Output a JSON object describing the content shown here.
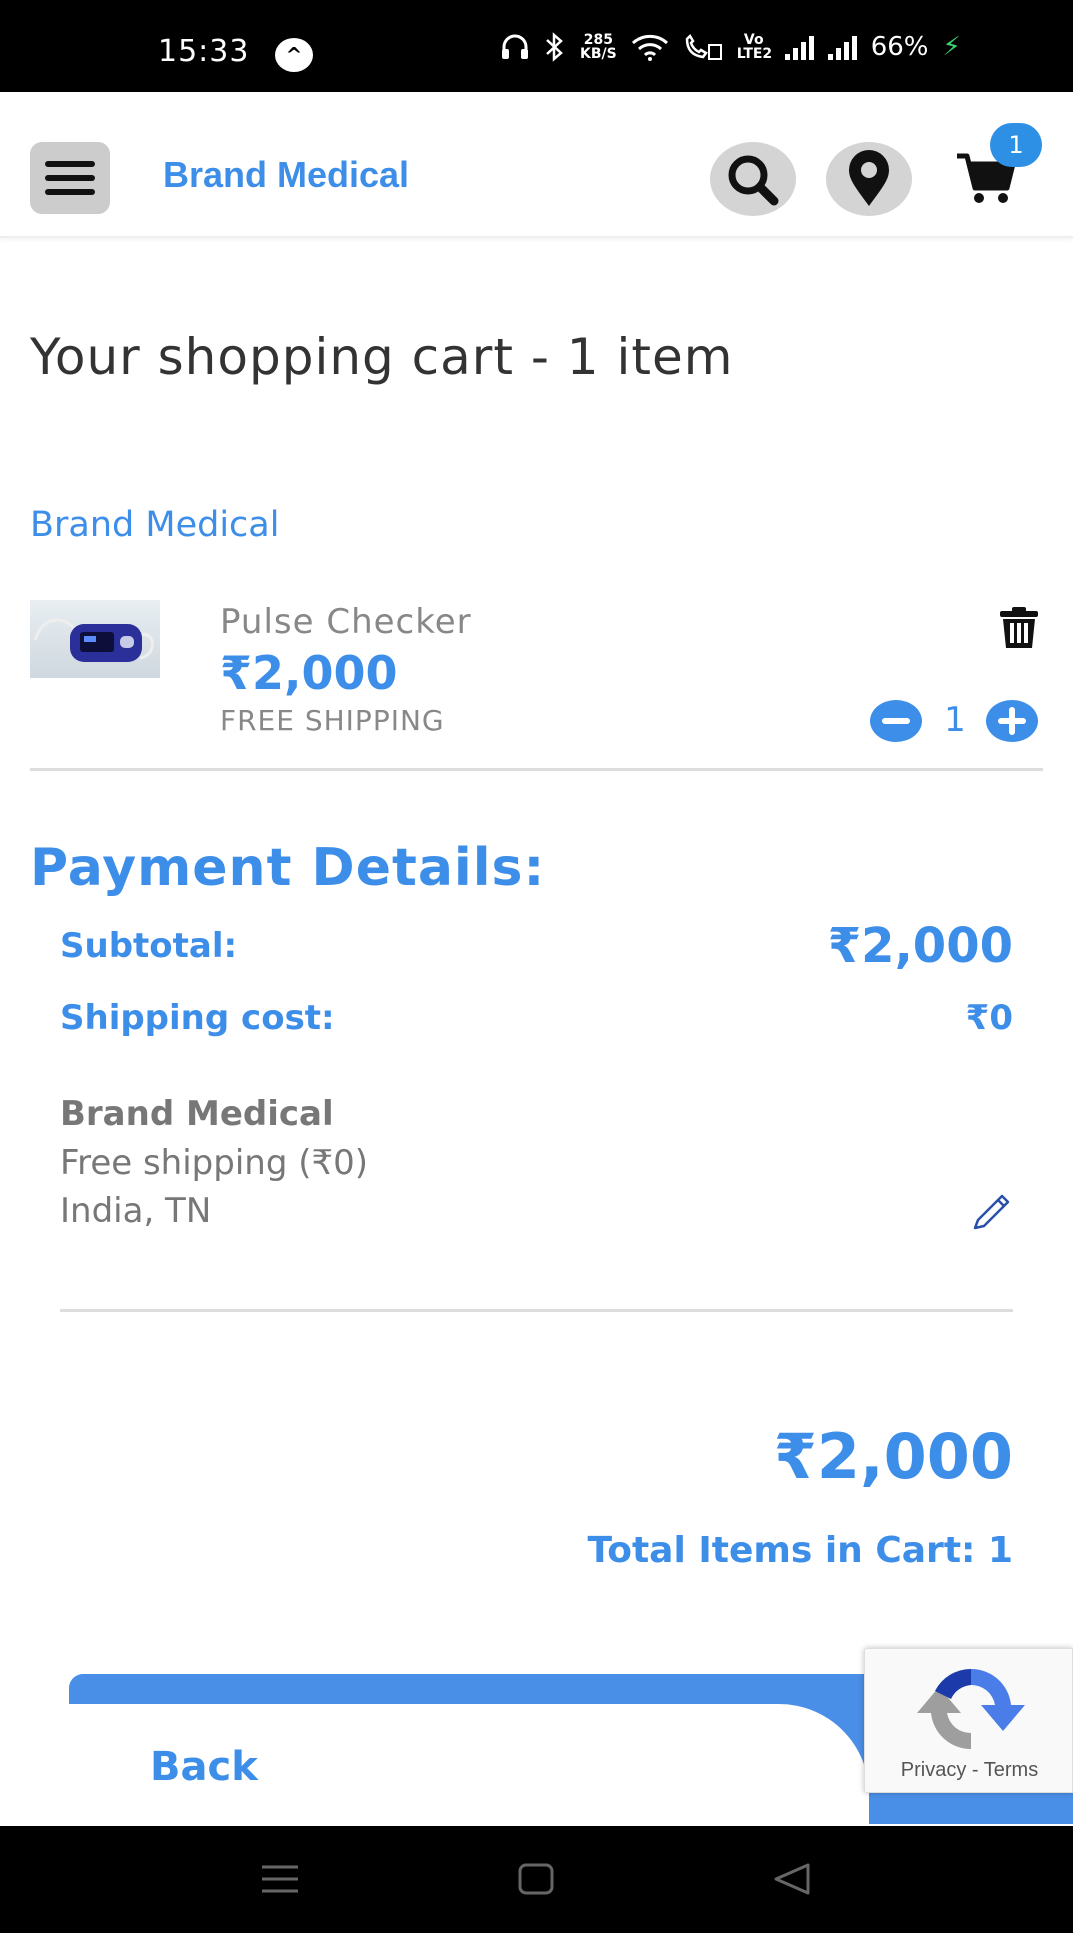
{
  "status_bar": {
    "time": "15:33",
    "net_speed_value": "285",
    "net_speed_unit": "KB/S",
    "volte": "Vo LTE2",
    "battery": "66%"
  },
  "header": {
    "brand": "Brand Medical",
    "cart_count": "1"
  },
  "cart": {
    "title": "Your shopping cart - 1 item",
    "seller": "Brand Medical",
    "items": [
      {
        "name": "Pulse Checker",
        "price": "₹2,000",
        "shipping": "FREE SHIPPING",
        "quantity": "1"
      }
    ]
  },
  "payment": {
    "title": "Payment Details:",
    "subtotal_label": "Subtotal:",
    "subtotal_value": "₹2,000",
    "shipping_label": "Shipping cost:",
    "shipping_value": "₹0",
    "shipping_seller": "Brand Medical",
    "shipping_method": "Free shipping (₹0)",
    "shipping_location": "India, TN",
    "total": "₹2,000",
    "total_items": "Total Items in Cart: 1"
  },
  "actions": {
    "back": "Back"
  },
  "recaptcha": {
    "privacy": "Privacy",
    "separator": " - ",
    "terms": "Terms"
  },
  "colors": {
    "accent": "#3d8ee8",
    "badge": "#2e90e5"
  }
}
